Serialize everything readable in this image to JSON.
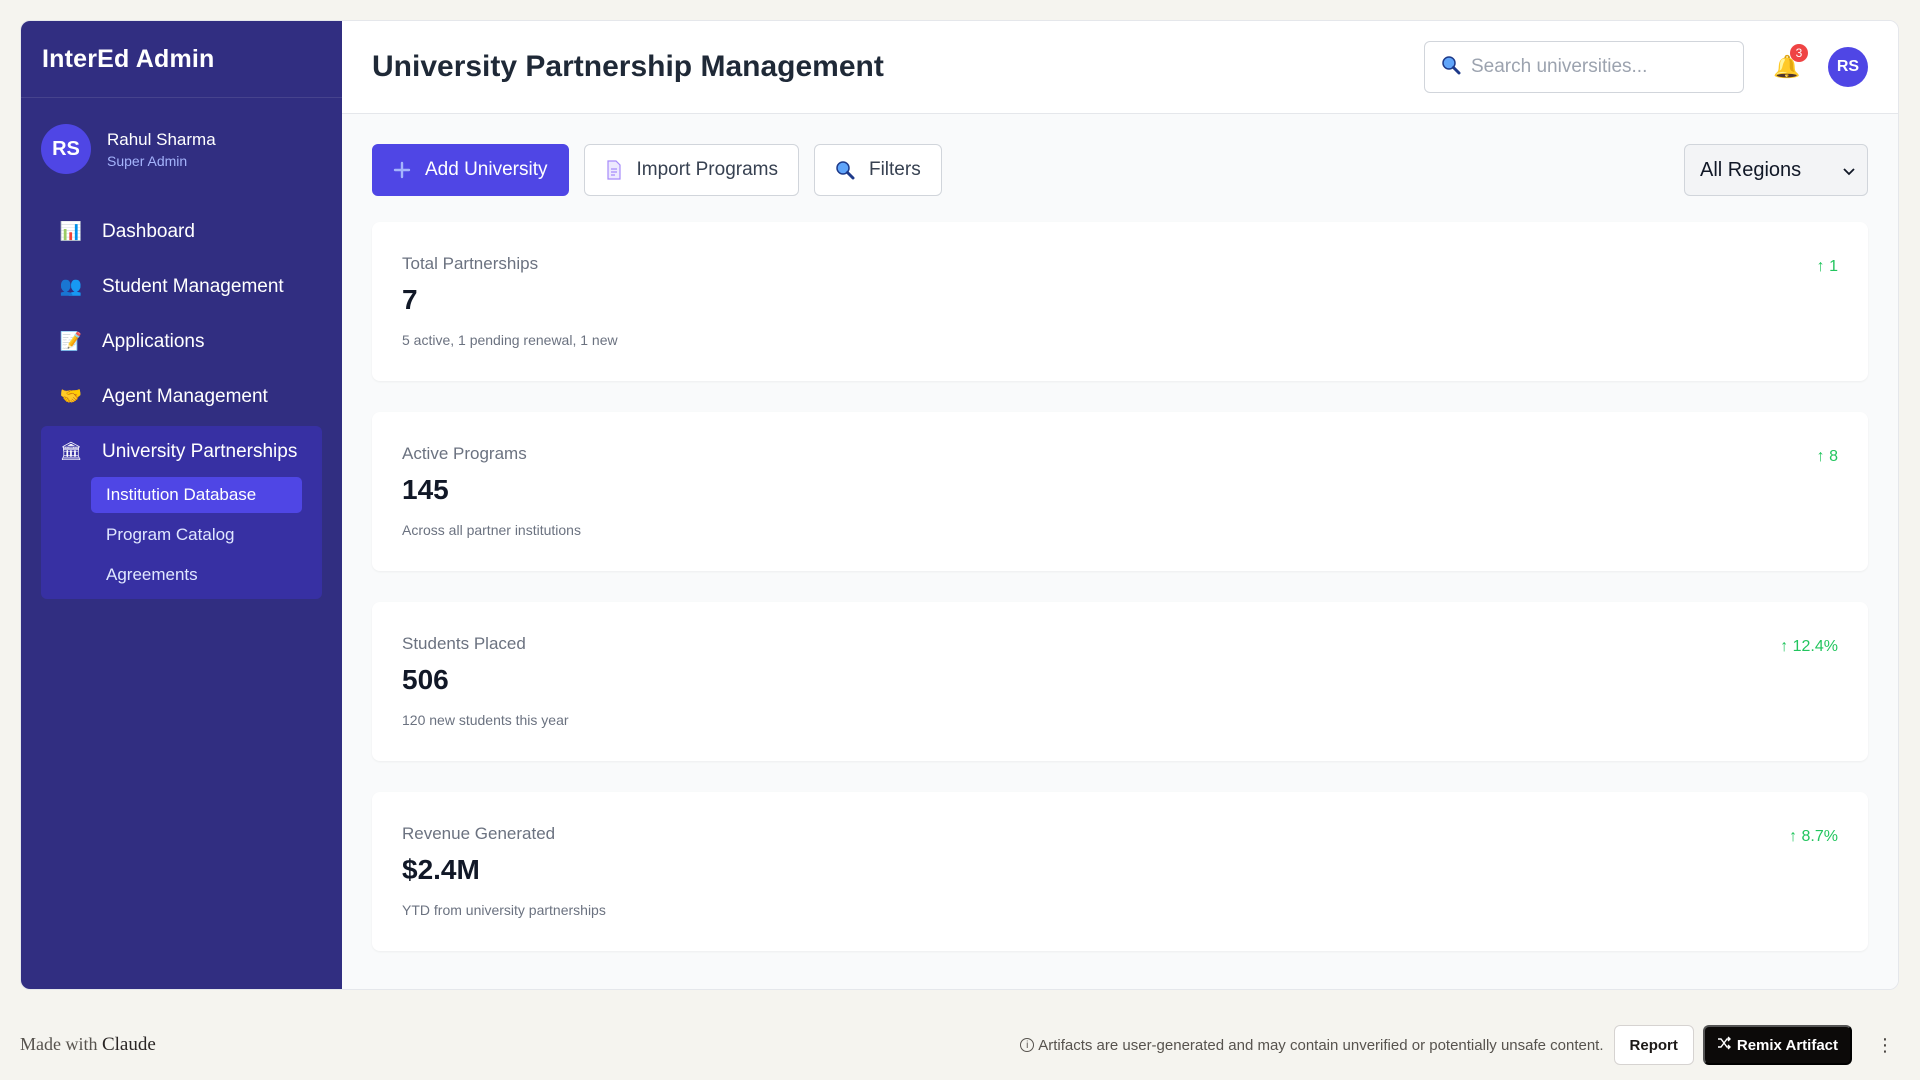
{
  "sidebar": {
    "brand": "InterEd Admin",
    "user": {
      "initials": "RS",
      "name": "Rahul Sharma",
      "role": "Super Admin"
    },
    "items": [
      {
        "label": "Dashboard",
        "icon": "📊"
      },
      {
        "label": "Student Management",
        "icon": "👥"
      },
      {
        "label": "Applications",
        "icon": "📝"
      },
      {
        "label": "Agent Management",
        "icon": "🤝"
      },
      {
        "label": "University Partnerships",
        "icon": "🏛"
      }
    ],
    "subitems": [
      "Institution Database",
      "Program Catalog",
      "Agreements"
    ]
  },
  "header": {
    "title": "University Partnership Management",
    "search_placeholder": "Search universities...",
    "notification_count": "3",
    "avatar_initials": "RS"
  },
  "toolbar": {
    "add_label": "Add University",
    "import_label": "Import Programs",
    "filters_label": "Filters",
    "region_selected": "All Regions"
  },
  "stats": [
    {
      "label": "Total Partnerships",
      "value": "7",
      "sub": "5 active, 1 pending renewal, 1 new",
      "trend": "↑ 1"
    },
    {
      "label": "Active Programs",
      "value": "145",
      "sub": "Across all partner institutions",
      "trend": "↑ 8"
    },
    {
      "label": "Students Placed",
      "value": "506",
      "sub": "120 new students this year",
      "trend": "↑ 12.4%"
    },
    {
      "label": "Revenue Generated",
      "value": "$2.4M",
      "sub": "YTD from university partnerships",
      "trend": "↑ 8.7%"
    }
  ],
  "footer": {
    "made_with": "Made with",
    "made_brand": "Claude",
    "disclaimer": "Artifacts are user-generated and may contain unverified or potentially unsafe content.",
    "report": "Report",
    "remix": "Remix Artifact"
  },
  "colors": {
    "sidebar": "#312e81",
    "accent": "#4f46e5",
    "trend": "#22c55e"
  }
}
